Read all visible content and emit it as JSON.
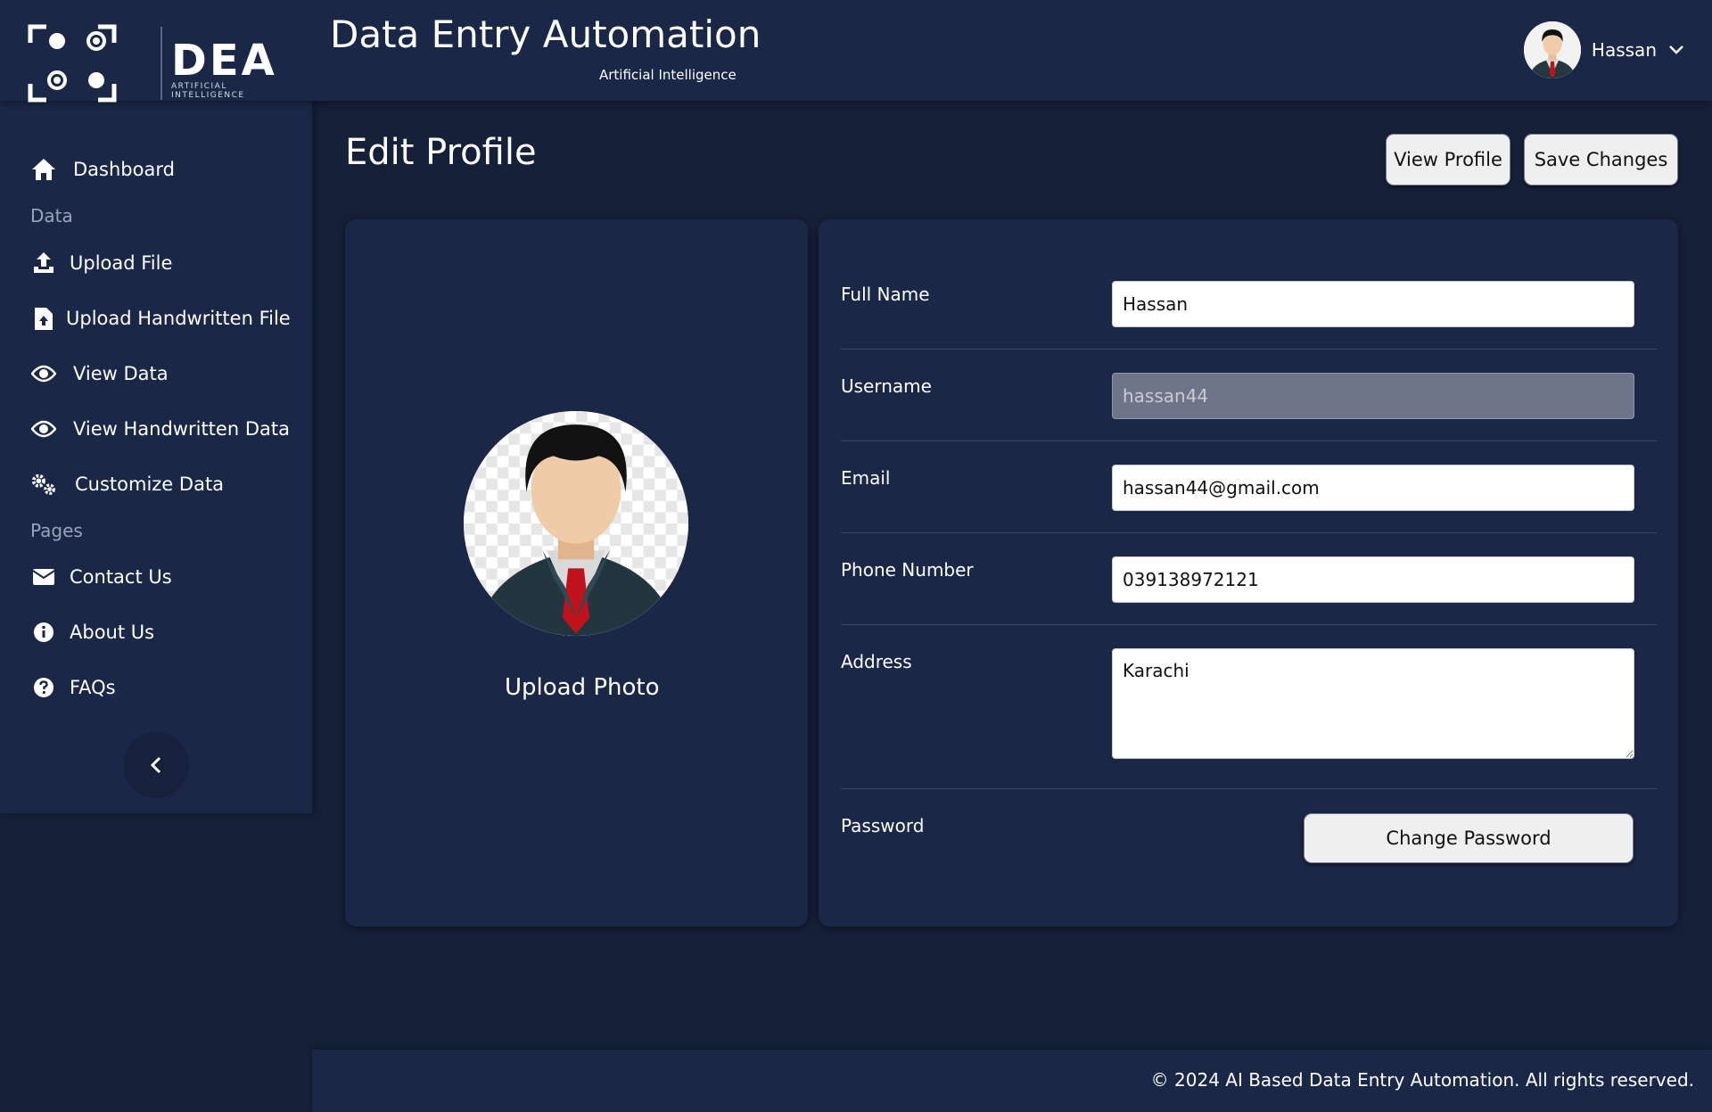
{
  "header": {
    "logo_text": "DEA",
    "logo_subtext": "ARTIFICIAL INTELLIGENCE",
    "title": "Data Entry Automation",
    "subtitle": "Artificial Intelligence",
    "user_name": "Hassan"
  },
  "sidebar": {
    "items": [
      {
        "label": "Dashboard",
        "icon": "home-icon"
      },
      {
        "label": "Upload File",
        "icon": "upload-icon"
      },
      {
        "label": "Upload Handwritten File",
        "icon": "file-upload-icon"
      },
      {
        "label": "View Data",
        "icon": "eye-icon"
      },
      {
        "label": "View Handwritten Data",
        "icon": "eye-icon"
      },
      {
        "label": "Customize Data",
        "icon": "gears-icon"
      },
      {
        "label": "Contact Us",
        "icon": "envelope-icon"
      },
      {
        "label": "About Us",
        "icon": "info-icon"
      },
      {
        "label": "FAQs",
        "icon": "question-icon"
      }
    ],
    "sections": {
      "data": "Data",
      "pages": "Pages"
    }
  },
  "main": {
    "page_title": "Edit Profile",
    "view_profile_label": "View Profile",
    "save_changes_label": "Save Changes",
    "upload_photo_label": "Upload Photo",
    "form": {
      "full_name": {
        "label": "Full Name",
        "value": "Hassan"
      },
      "username": {
        "label": "Username",
        "value": "hassan44"
      },
      "email": {
        "label": "Email",
        "value": "hassan44@gmail.com"
      },
      "phone": {
        "label": "Phone Number",
        "value": "039138972121"
      },
      "address": {
        "label": "Address",
        "value": "Karachi"
      },
      "password": {
        "label": "Password",
        "button_label": "Change Password"
      }
    }
  },
  "footer": {
    "text": "© 2024 AI Based Data Entry Automation. All rights reserved."
  },
  "colors": {
    "background": "#172039",
    "panel": "#1b2746",
    "button": "#efefef"
  }
}
